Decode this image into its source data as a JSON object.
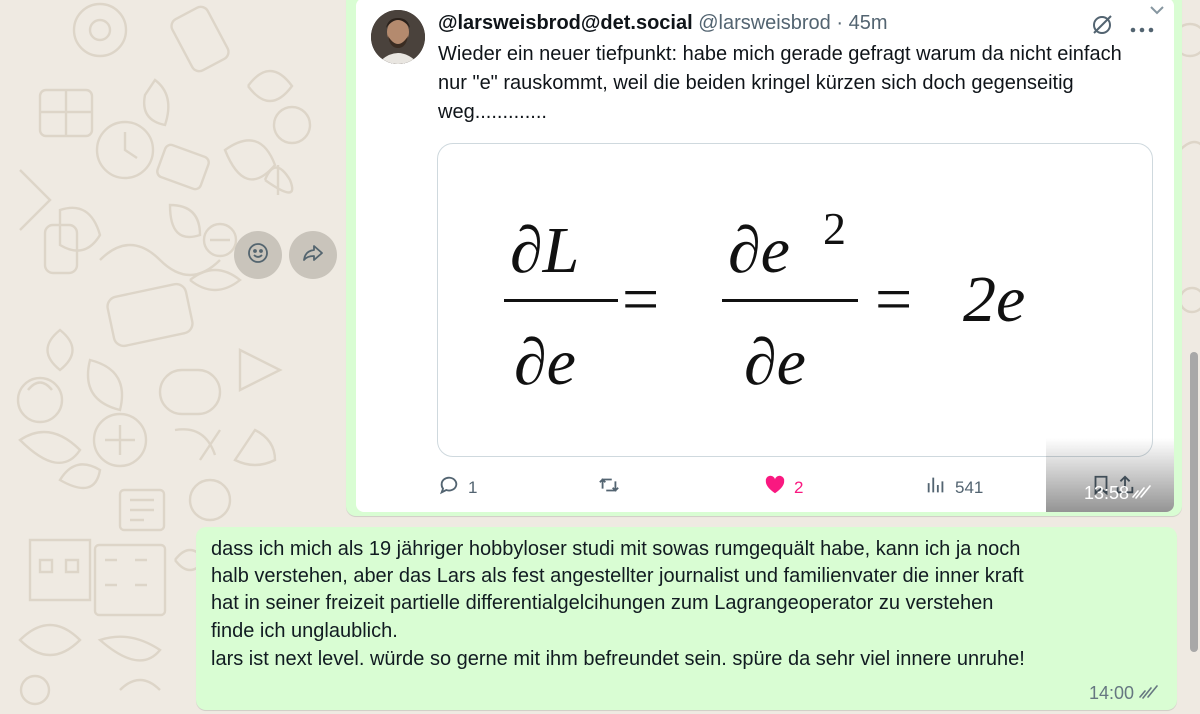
{
  "colors": {
    "chat_background": "#efeae2",
    "outgoing_bubble": "#d9fdd3",
    "like_pink": "#f91880",
    "tick_gray": "#667781"
  },
  "icons": {
    "emoji_reaction": "smiley-icon",
    "forward": "forward-icon",
    "reply": "reply-bubble-icon",
    "retweet": "retweet-icon",
    "like": "heart-icon",
    "views": "bar-chart-icon",
    "bookmark": "bookmark-icon",
    "share": "share-icon",
    "grok": "grok-icon",
    "more": "more-dots-icon",
    "read": "double-check-icon"
  },
  "image_message": {
    "tweet": {
      "author_name": "@larsweisbrod@det.social",
      "handle": "@larsweisbrod",
      "separator": "·",
      "age": "45m",
      "text": "Wieder ein neuer tiefpunkt: habe mich gerade gefragt warum da nicht einfach nur \"e\" rauskommt, weil die beiden kringel kürzen sich doch gegenseitig weg.............",
      "formula": {
        "num1": "∂L",
        "den1": "∂e",
        "eq": "=",
        "num2": "∂e",
        "exp2": "2",
        "den2": "∂e",
        "result": "2e"
      },
      "stats": {
        "replies": "1",
        "likes": "2",
        "views": "541"
      }
    },
    "time": "13:58"
  },
  "text_message": {
    "lines": [
      "dass ich mich als 19 jähriger hobbyloser studi mit sowas rumgequält habe, kann ich ja noch",
      "halb verstehen, aber das Lars als fest angestellter journalist und familienvater die inner kraft",
      "hat in seiner freizeit partielle differentialgelcihungen zum Lagrangeoperator zu verstehen",
      "finde ich unglaublich.",
      "lars ist next level. würde so gerne mit ihm befreundet sein. spüre da sehr viel innere unruhe!"
    ],
    "time": "14:00"
  }
}
